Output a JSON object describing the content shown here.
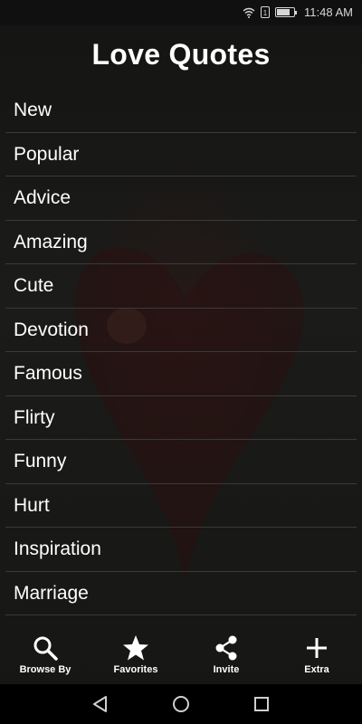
{
  "status_bar": {
    "time": "11:48 AM",
    "sim_label": "1",
    "battery_level": 0.8,
    "icons": [
      "wifi-icon",
      "sim-icon",
      "battery-icon"
    ]
  },
  "app": {
    "title": "Love Quotes"
  },
  "categories": [
    "New",
    "Popular",
    "Advice",
    "Amazing",
    "Cute",
    "Devotion",
    "Famous",
    "Flirty",
    "Funny",
    "Hurt",
    "Inspiration",
    "Marriage"
  ],
  "bottom_nav": [
    {
      "label": "Browse By",
      "icon": "search-icon"
    },
    {
      "label": "Favorites",
      "icon": "star-icon"
    },
    {
      "label": "Invite",
      "icon": "share-icon"
    },
    {
      "label": "Extra",
      "icon": "plus-icon"
    }
  ],
  "system_nav": {
    "icons": [
      "back-icon",
      "home-icon",
      "recents-icon"
    ]
  },
  "colors": {
    "background": "#141413",
    "text": "#ffffff",
    "divider": "#3a3a38",
    "heart_tint": "#3c1412"
  }
}
